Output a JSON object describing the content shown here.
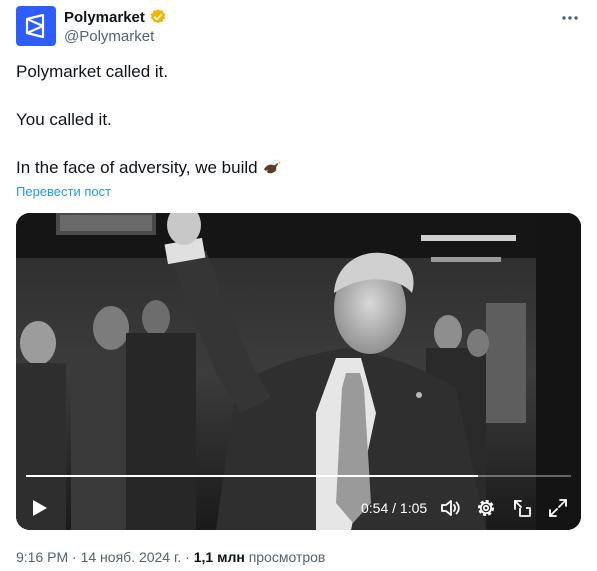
{
  "author": {
    "display_name": "Polymarket",
    "handle": "@Polymarket",
    "verified_badge_color": "#f4b400",
    "avatar_color": "#2e5cff"
  },
  "post": {
    "lines": [
      "Polymarket called it.",
      "You called it.",
      "In the face of adversity, we build"
    ],
    "emoji": "eagle-icon",
    "translate_label": "Перевести пост"
  },
  "video": {
    "current_time": "0:54",
    "separator": "/",
    "duration": "1:05",
    "progress_fraction": 0.83
  },
  "meta": {
    "time": "9:16 PM",
    "dot": "·",
    "date": "14 нояб. 2024 г.",
    "views_count": "1,1 млн",
    "views_label": "просмотров"
  },
  "colors": {
    "link": "#1d9bf0",
    "secondary_text": "#536471"
  }
}
